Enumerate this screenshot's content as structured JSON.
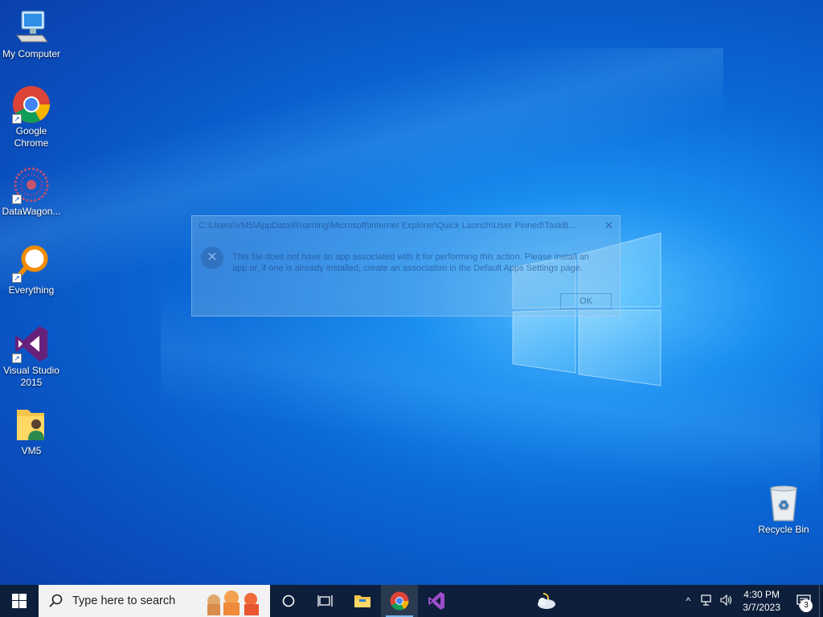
{
  "desktop": {
    "icons": [
      {
        "label": "My Computer"
      },
      {
        "label": "Google Chrome"
      },
      {
        "label": "DataWagon..."
      },
      {
        "label": "Everything"
      },
      {
        "label": "Visual Studio 2015"
      },
      {
        "label": "VM5"
      },
      {
        "label": "Recycle Bin"
      }
    ]
  },
  "dialog": {
    "title": "C:\\Users\\VM5\\AppData\\Roaming\\Microsoft\\Internet Explorer\\Quick Launch\\User Pinned\\TaskB...",
    "close": "✕",
    "message": "This file does not have an app associated with it for performing this action. Please install an app or, if one is already installed, create an association in the Default Apps Settings page.",
    "ok_label": "OK",
    "icon": "error-icon"
  },
  "taskbar": {
    "search_placeholder": "Type here to search",
    "pinned": [
      "cortana-icon",
      "task-view-icon",
      "file-explorer-icon",
      "chrome-icon",
      "visual-studio-icon",
      "weather-icon"
    ],
    "clock_time": "4:30 PM",
    "clock_date": "3/7/2023",
    "notification_count": "3"
  },
  "colors": {
    "taskbar": "#0d1f3a",
    "accent": "#76b9ed",
    "desktop": "#0a6ad8"
  }
}
